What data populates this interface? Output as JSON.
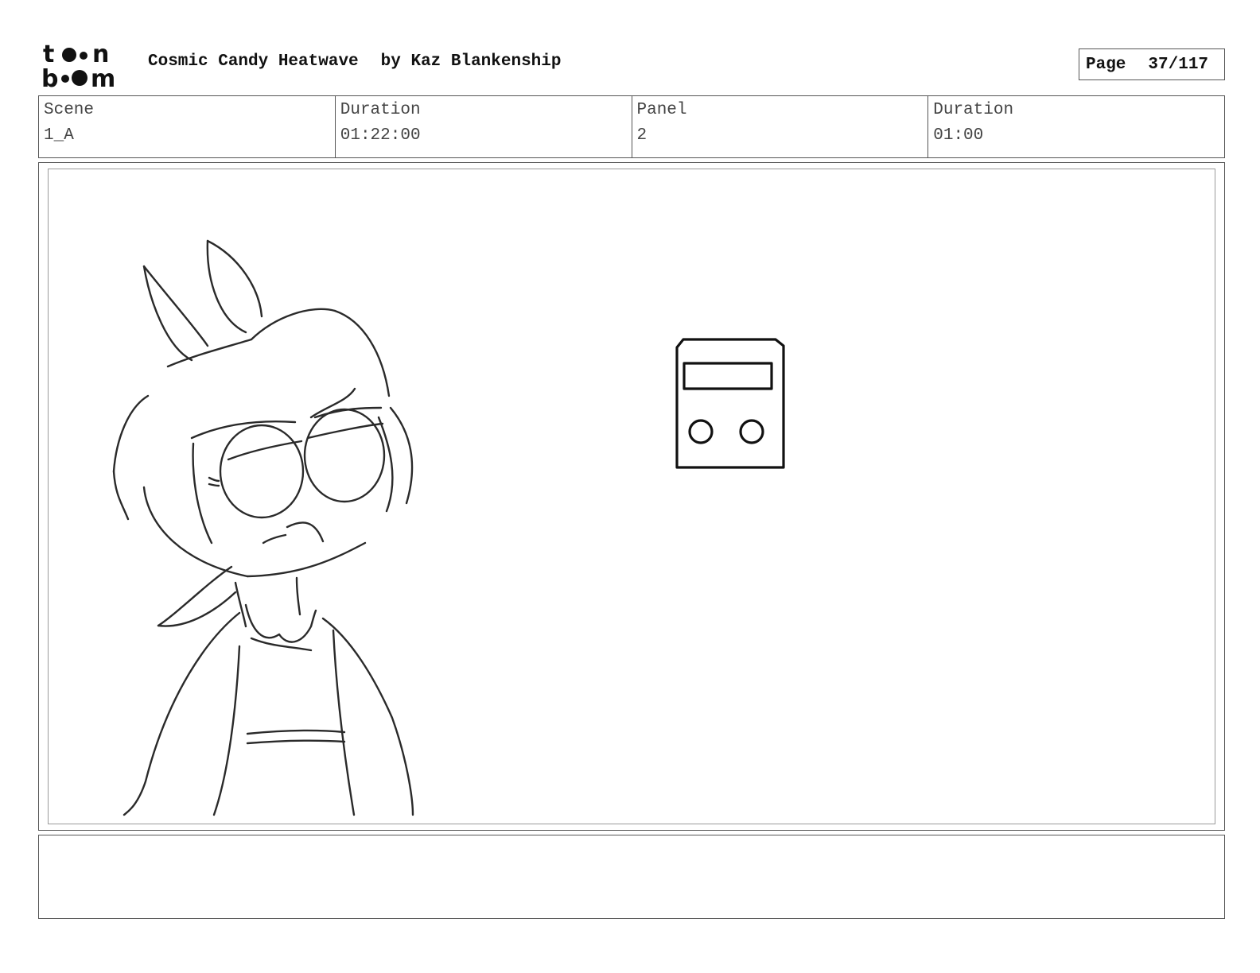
{
  "header": {
    "logo_text": "toon boom",
    "title": "Cosmic Candy Heatwave",
    "author": "by Kaz Blankenship",
    "page_label": "Page",
    "page_number": "37/117"
  },
  "info": {
    "scene_label": "Scene",
    "scene_value": "1_A",
    "duration_label": "Duration",
    "duration_value": "01:22:00",
    "panel_label": "Panel",
    "panel_value": "2",
    "panel_duration_label": "Duration",
    "panel_duration_value": "01:00"
  },
  "notes": {
    "text": ""
  }
}
